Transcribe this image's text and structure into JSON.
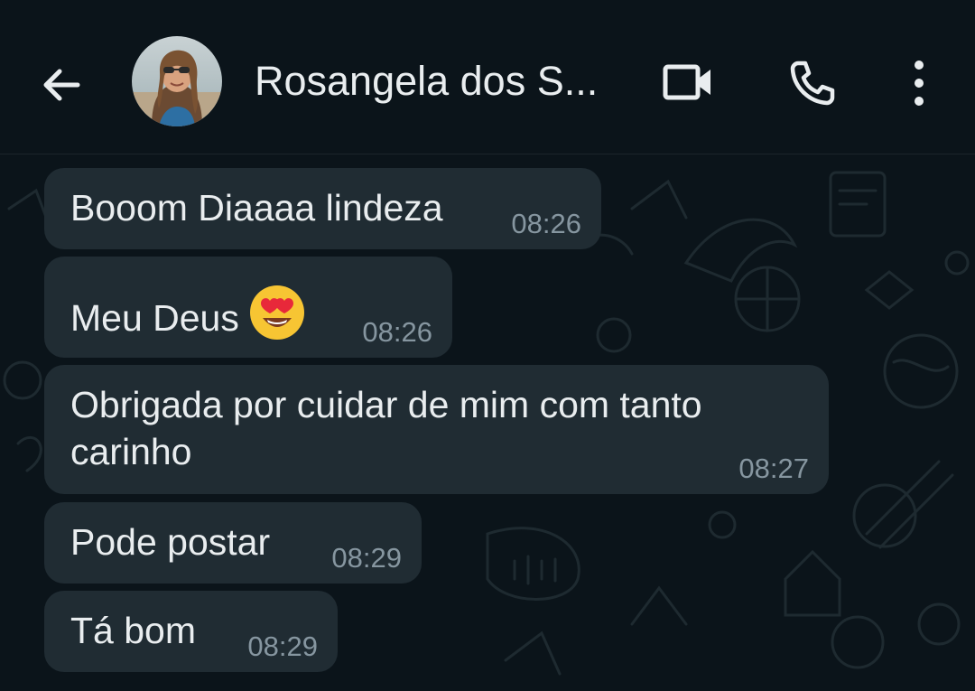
{
  "header": {
    "back_icon": "arrow-left-icon",
    "contact_name": "Rosangela dos S...",
    "video_icon": "video-camera-icon",
    "call_icon": "phone-icon",
    "menu_icon": "more-vertical-icon"
  },
  "messages": [
    {
      "text": "Booom Diaaaa lindeza",
      "time": "08:26"
    },
    {
      "text": "Meu Deus",
      "emoji": "heart-eyes-emoji",
      "time": "08:26"
    },
    {
      "text": "Obrigada por cuidar de mim com tanto carinho",
      "time": "08:27"
    },
    {
      "text": "Pode postar",
      "time": "08:29"
    },
    {
      "text": "Tá bom",
      "time": "08:29"
    }
  ],
  "colors": {
    "background": "#0b141a",
    "bubble_incoming": "#202c33",
    "text_primary": "#e9edef",
    "text_secondary": "#8696a0"
  }
}
